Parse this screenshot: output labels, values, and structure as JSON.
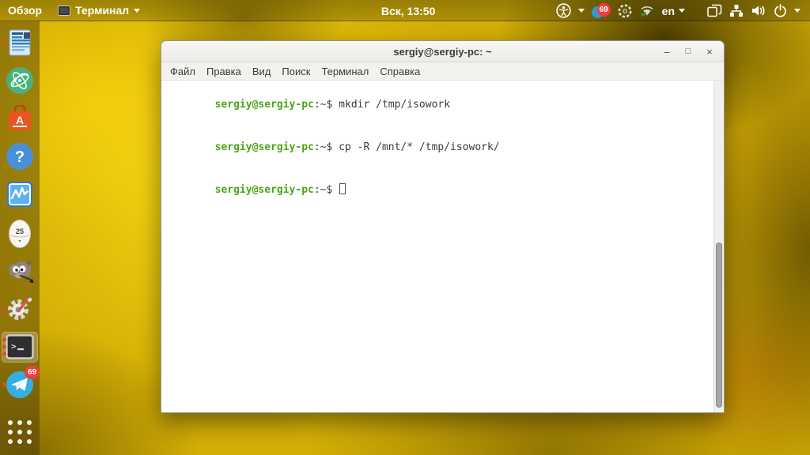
{
  "top_bar": {
    "activities": "Обзор",
    "app_menu_label": "Терминал",
    "clock": "Вск, 13:50",
    "keyboard_layout": "en",
    "telegram_badge": "69",
    "tray_icons": [
      "accessibility-icon",
      "telegram-tray-icon",
      "shutter-icon",
      "wifi-icon",
      "displays-icon",
      "wired-network-icon",
      "volume-icon",
      "power-icon"
    ]
  },
  "dock": {
    "telegram_badge": "69",
    "egg_timer_label": "25",
    "icons": [
      "document-viewer-icon",
      "atom-editor-icon",
      "ubuntu-software-icon",
      "help-icon",
      "system-monitor-icon",
      "egg-timer-icon",
      "gimp-icon",
      "settings-tools-icon",
      "terminal-icon",
      "telegram-icon",
      "app-grid-icon"
    ]
  },
  "window": {
    "title": "sergiy@sergiy-pc: ~",
    "controls": {
      "minimize": "–",
      "maximize": "□",
      "close": "×"
    },
    "menu": [
      "Файл",
      "Правка",
      "Вид",
      "Поиск",
      "Терминал",
      "Справка"
    ],
    "terminal": {
      "lines": [
        {
          "prompt": "sergiy@sergiy-pc",
          "suffix": ":~$",
          "command": " mkdir /tmp/isowork"
        },
        {
          "prompt": "sergiy@sergiy-pc",
          "suffix": ":~$",
          "command": " cp -R /mnt/* /tmp/isowork/"
        },
        {
          "prompt": "sergiy@sergiy-pc",
          "suffix": ":~$",
          "command": ""
        }
      ]
    }
  },
  "colors": {
    "prompt_green": "#4ca616",
    "badge_red": "#ef3d3d",
    "telegram_blue": "#37aee2",
    "software_orange": "#e95420",
    "panel_text": "#ffffff"
  }
}
